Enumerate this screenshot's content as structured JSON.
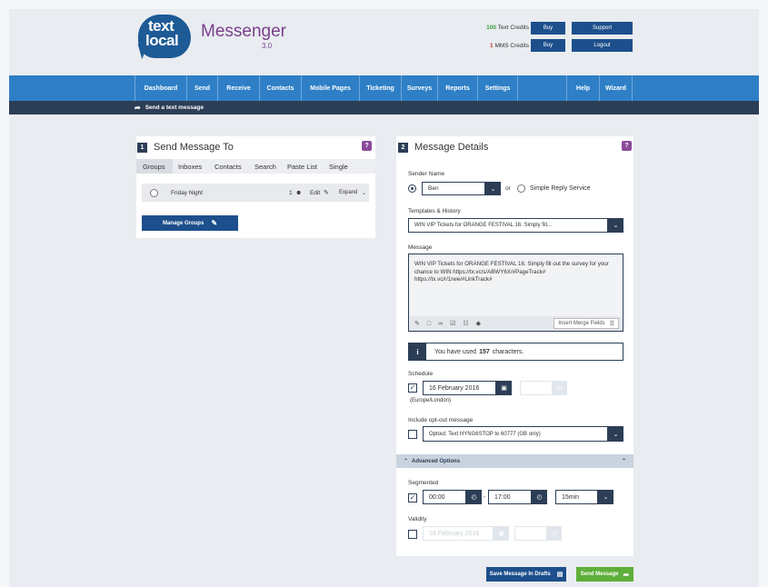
{
  "brand": {
    "logo_line1": "text",
    "logo_line2": "local",
    "name": "Messenger",
    "version": "3.0"
  },
  "credits": {
    "text_count": "100",
    "text_label": "Text Credits",
    "mms_count": "1",
    "mms_label": "MMS Credits",
    "buy_label": "Buy",
    "support_label": "Support",
    "logout_label": "Logout"
  },
  "nav": [
    "Dashboard",
    "Send",
    "Receive",
    "Contacts",
    "Mobile Pages",
    "Ticketing",
    "Surveys",
    "Reports",
    "Settings",
    "Help",
    "Wizard"
  ],
  "subbar": {
    "title": "Send a text message"
  },
  "left": {
    "number": "1",
    "title": "Send Message To",
    "help": "?",
    "tabs": [
      "Groups",
      "Inboxes",
      "Contacts",
      "Search",
      "Paste List",
      "Single"
    ],
    "group": {
      "name": "Friday Night",
      "count": "1",
      "edit": "Edit",
      "expand": "Expand"
    },
    "manage_label": "Manage Groups"
  },
  "right": {
    "number": "2",
    "title": "Message Details",
    "help": "?",
    "sender_label": "Sender Name",
    "sender_value": "Ben",
    "or": "or",
    "simple_reply": "Simple Reply Service",
    "templates_label": "Templates & History",
    "templates_value": "WIN VIP Tickets for ORANGE FESTIVAL 16. Simply fill...",
    "message_label": "Message",
    "message_line1": "WIN VIP Tickets for ORANGE FESTIVAL 16. Simply fill out the survey for your",
    "message_line2": "chance to WIN https://tx.vc/s/ABWY6X/#PageTrack#",
    "message_line3": "https://tx.vc/r/1rwe/#LinkTrack#",
    "merge_label": "Insert Merge Fields",
    "info_pre": "You have used",
    "info_count": "157",
    "info_post": "characters.",
    "schedule_label": "Schedule",
    "schedule_date": "16 February 2016",
    "timezone": "(Europe/London)",
    "optout_label": "Include opt-out message",
    "optout_value": "Optout: Text HYNG6STOP to 60777 (GB only)",
    "advanced_label": "Advanced Options",
    "segmented_label": "Segmented",
    "seg_start": "00:00",
    "seg_end": "17:00",
    "seg_interval": "15min",
    "validity_label": "Validity",
    "validity_date": "18 February 2016"
  },
  "footer": {
    "drafts_label": "Save Message In Drafts",
    "send_label": "Send Message"
  }
}
